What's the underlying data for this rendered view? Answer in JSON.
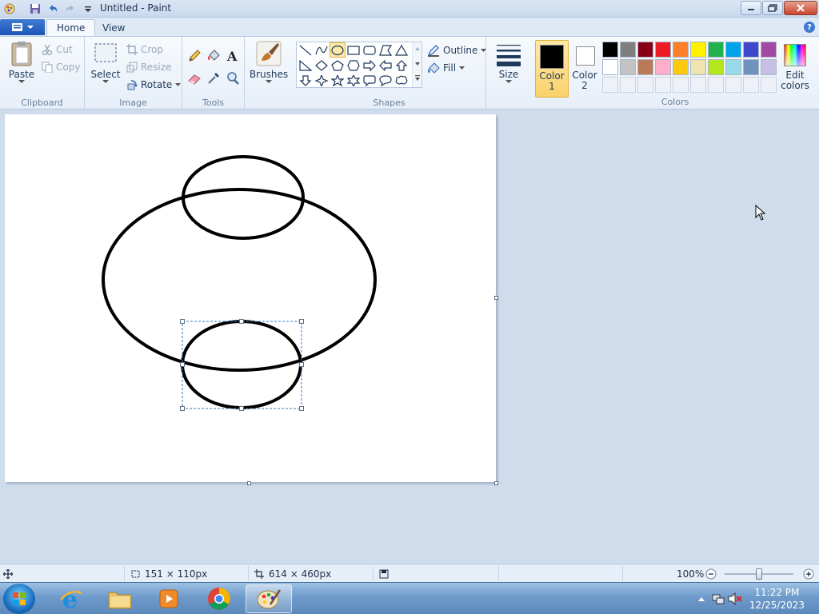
{
  "window": {
    "title": "Untitled - Paint"
  },
  "tabs": [
    {
      "label": "Home"
    },
    {
      "label": "View"
    }
  ],
  "help_label": "?",
  "clipboard": {
    "paste": "Paste",
    "cut": "Cut",
    "copy": "Copy",
    "group": "Clipboard"
  },
  "image": {
    "select": "Select",
    "crop": "Crop",
    "resize": "Resize",
    "rotate": "Rotate",
    "group": "Image"
  },
  "tools": {
    "group": "Tools"
  },
  "brushes": {
    "label": "Brushes"
  },
  "shapes": {
    "outline": "Outline",
    "fill": "Fill",
    "group": "Shapes",
    "selected": "oval"
  },
  "size": {
    "label": "Size"
  },
  "colors": {
    "color1_label": "Color\n1",
    "color1_line1": "Color",
    "color1_line2": "1",
    "color2_line1": "Color",
    "color2_line2": "2",
    "edit_line1": "Edit",
    "edit_line2": "colors",
    "group": "Colors",
    "color1": "#000000",
    "color2": "#ffffff",
    "row1": [
      "#000000",
      "#7f7f7f",
      "#880015",
      "#ed1c24",
      "#ff7f27",
      "#fff200",
      "#22b14c",
      "#00a2e8",
      "#3f48cc",
      "#a349a4"
    ],
    "row2": [
      "#ffffff",
      "#c3c3c3",
      "#b97a57",
      "#ffaec9",
      "#ffc90e",
      "#efe4b0",
      "#b5e61d",
      "#99d9ea",
      "#7092be",
      "#c8bfe7"
    ]
  },
  "status": {
    "selection_size": "151 × 110px",
    "canvas_size": "614 × 460px",
    "zoom": "100%",
    "zoom_level": 1.0
  },
  "taskbar": {
    "time": "11:22 PM",
    "date": "12/25/2023"
  }
}
